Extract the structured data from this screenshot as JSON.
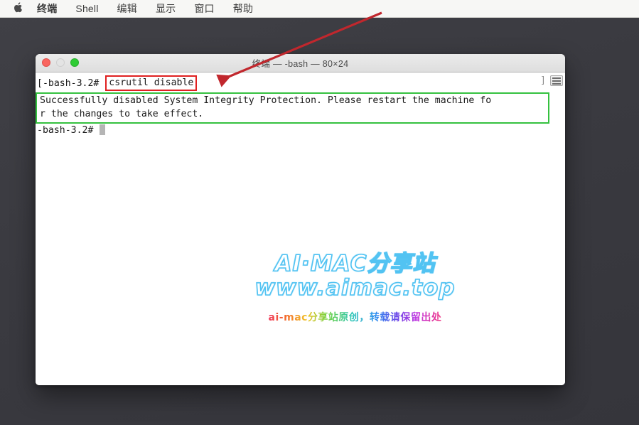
{
  "menubar": {
    "apple_icon": "apple-logo-icon",
    "apple_glyph": "",
    "items": [
      {
        "label": "终端",
        "bold": true
      },
      {
        "label": "Shell",
        "bold": false
      },
      {
        "label": "编辑",
        "bold": false
      },
      {
        "label": "显示",
        "bold": false
      },
      {
        "label": "窗口",
        "bold": false
      },
      {
        "label": "帮助",
        "bold": false
      }
    ]
  },
  "window": {
    "title": "终端 — -bash — 80×24",
    "controls": {
      "close": "close-button",
      "minimize": "minimize-button",
      "zoom": "zoom-button"
    }
  },
  "terminal": {
    "prompt_1": "[-bash-3.2# ",
    "command": "csrutil disable",
    "output_line_1": "Successfully disabled System Integrity Protection. Please restart the machine fo",
    "output_line_2": "r the changes to take effect.",
    "prompt_2": "-bash-3.2# ",
    "bracket_mark": "]",
    "split_icon": "split-pane-icon"
  },
  "annotations": {
    "command_box_color": "#e02020",
    "output_box_color": "#35c13f",
    "arrow_color": "#c1272d",
    "arrow_label": "red-pointer-arrow"
  },
  "watermark": {
    "line1": "AI·MAC分享站",
    "line2": "www.aimac.top",
    "line3": "ai-mac分享站原创，转载请保留出处"
  },
  "colors": {
    "desktop": "#3b3b41",
    "menubar": "#f7f7f5",
    "titlebar": "#e3e3e3",
    "terminal_bg": "#ffffff",
    "terminal_text": "#1a1a1a"
  }
}
